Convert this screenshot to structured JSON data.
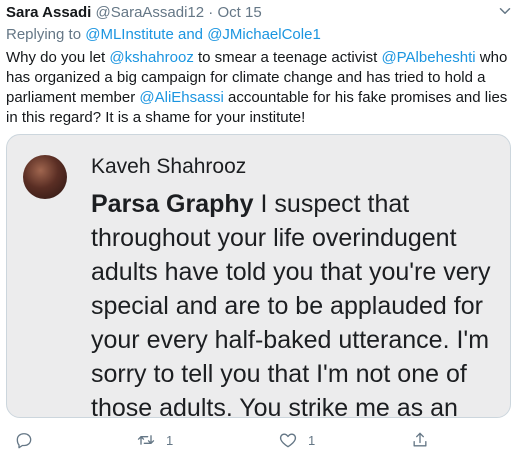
{
  "tweet": {
    "author_name": "Sara Assadi",
    "author_handle": "@SaraAssadi12",
    "separator": "·",
    "date": "Oct 15",
    "replying_prefix": "Replying to",
    "replying_user1": "@MLInstitute",
    "replying_and": "and",
    "replying_user2": "@JMichaelCole1",
    "text_part1": "Why do you let ",
    "mention1": "@kshahrooz",
    "text_part2": " to smear a teenage activist ",
    "mention2": "@PAlbeheshti",
    "text_part3": "  who has organized a big campaign for climate change and has tried to hold a parliament member ",
    "mention3": "@AliEhsassi",
    "text_part4": " accountable for his fake promises and lies in this regard? It is a shame for your institute!"
  },
  "embedded_comment": {
    "commenter_name": "Kaveh Shahrooz",
    "reply_to_name": "Parsa Graphy",
    "comment_text": " I suspect that throughout your life overindugent adults have told you that you're very special and are to be applauded for your every half-baked utterance. I'm sorry to tell you that I'm not one of those adults. You strike me as an"
  },
  "actions": {
    "reply_icon": "reply-icon",
    "retweet_icon": "retweet-icon",
    "retweet_count": "1",
    "like_icon": "like-icon",
    "like_count": "1",
    "share_icon": "share-icon"
  },
  "colors": {
    "link": "#1b95e0",
    "muted": "#657786",
    "card_bg": "#ececed"
  }
}
